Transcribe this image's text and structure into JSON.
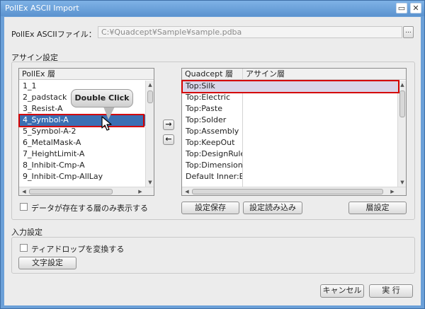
{
  "window": {
    "title": "PollEx ASCII Import",
    "minimize_glyph": "▭",
    "close_glyph": "✕"
  },
  "file": {
    "label": "PollEx ASCIIファイル：",
    "path": "C:¥Quadcept¥Sample¥sample.pdba",
    "browse_label": "..."
  },
  "assign": {
    "section_title": "アサイン設定",
    "left_list": {
      "header": "PollEx 層",
      "rows": [
        "1_1",
        "2_padstack",
        "3_Resist-A",
        "4_Symbol-A",
        "5_Symbol-A-2",
        "6_MetalMask-A",
        "7_HeightLimit-A",
        "8_Inhibit-Cmp-A",
        "9_Inhibit-Cmp-AllLay"
      ],
      "selected_index": 3
    },
    "right_list": {
      "headers": [
        "Quadcept 層",
        "アサイン層"
      ],
      "rows": [
        "Top:Silk",
        "Top:Electric",
        "Top:Paste",
        "Top:Solder",
        "Top:Assembly",
        "Top:KeepOut",
        "Top:DesignRule",
        "Top:Dimension",
        "Default Inner:Ele"
      ],
      "highlight_index": 0
    },
    "move_right_glyph": "→",
    "move_left_glyph": "←",
    "show_only_existing_label": "データが存在する層のみ表示する",
    "save_settings_label": "設定保存",
    "load_settings_label": "設定読み込み",
    "layer_settings_label": "層設定"
  },
  "tooltip": {
    "text": "Double Click"
  },
  "input": {
    "section_title": "入力設定",
    "teardrop_label": "ティアドロップを変換する",
    "text_settings_label": "文字設定"
  },
  "footer": {
    "cancel_label": "キャンセル",
    "run_label": "実 行"
  },
  "colors": {
    "selection": "#3b6fb3",
    "highlight": "#d40000",
    "titlebar": "#6ba0d8"
  }
}
